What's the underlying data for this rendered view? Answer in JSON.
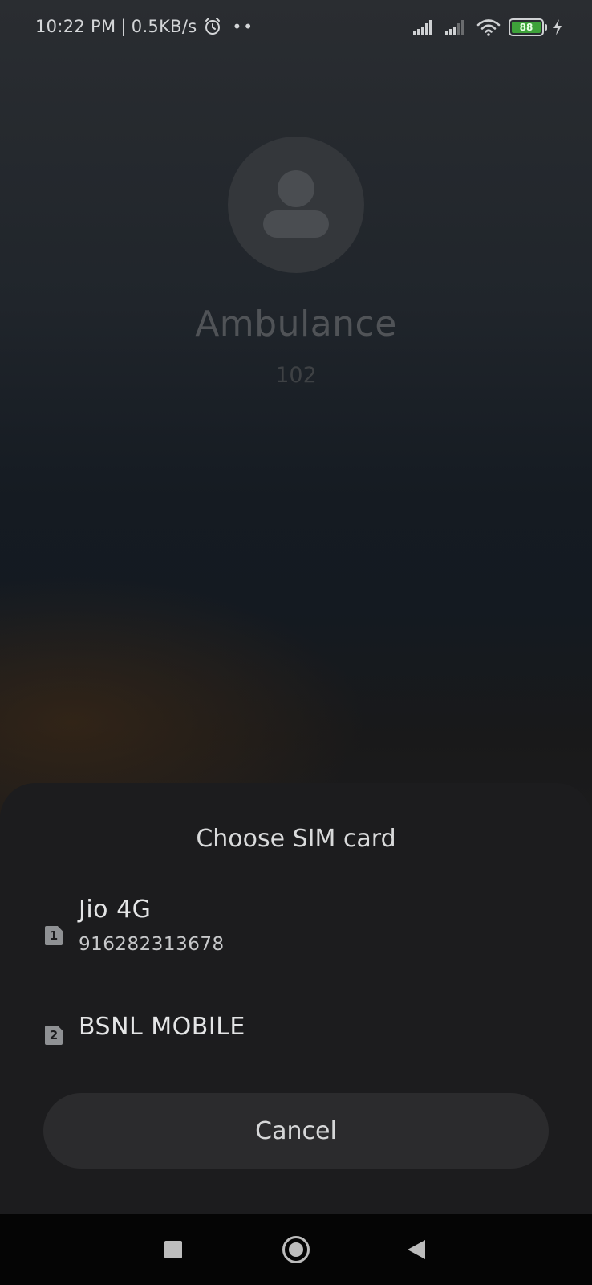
{
  "status_bar": {
    "time": "10:22 PM",
    "separator": "|",
    "network_speed": "0.5KB/s",
    "more_indicator": "••",
    "battery_level": "88",
    "icons": [
      "alarm-icon",
      "signal-sim1-icon",
      "signal-sim2-icon",
      "wifi-icon",
      "battery-icon",
      "charging-icon"
    ],
    "battery_color": "#3ea23a"
  },
  "contact": {
    "name": "Ambulance",
    "number": "102",
    "avatar_icon": "person-placeholder-icon"
  },
  "sim_dialog": {
    "title": "Choose SIM card",
    "sims": [
      {
        "badge": "1",
        "name": "Jio 4G",
        "number": "916282313678",
        "icon": "sim-card-1-icon"
      },
      {
        "badge": "2",
        "name": "BSNL MOBILE",
        "icon": "sim-card-2-icon"
      }
    ],
    "cancel_label": "Cancel"
  },
  "nav_bar": {
    "icons": [
      "recents-square-icon",
      "home-circle-icon",
      "back-triangle-icon"
    ]
  }
}
